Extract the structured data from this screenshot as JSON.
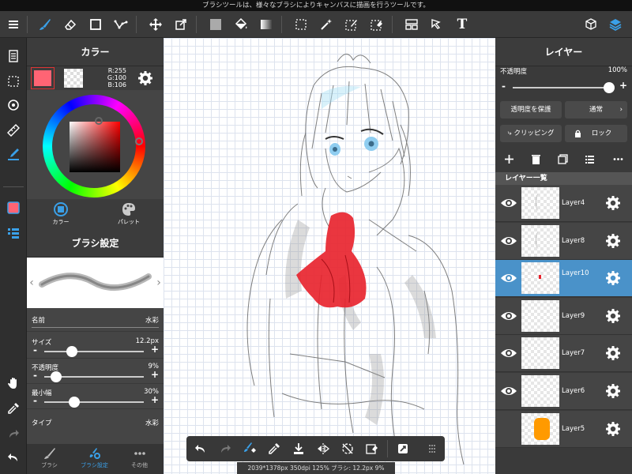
{
  "hint": "ブラシツールは、様々なブラシによりキャンバスに描画を行うツールです。",
  "toolbar": {
    "icons": [
      "menu-icon",
      "brush-icon",
      "eraser-icon",
      "rect-icon",
      "smooth-icon",
      "move-icon",
      "transform-icon",
      "fill-icon",
      "bucket-icon",
      "gradient-icon",
      "select-icon",
      "magic-wand-icon",
      "select-pen-icon",
      "select-eraser-icon",
      "layout-icon",
      "operation-icon",
      "text-icon",
      "3d-icon",
      "layers-icon"
    ],
    "text_tool_glyph": "T"
  },
  "color_panel": {
    "title": "カラー",
    "r": "R:255",
    "g": "G:100",
    "b": "B:106",
    "tab_color": "カラー",
    "tab_palette": "パレット",
    "primary": "#ff6474"
  },
  "brush_panel": {
    "title": "ブラシ設定",
    "name_label": "名前",
    "name_value": "水彩",
    "size_label": "サイズ",
    "size_value": "12.2px",
    "size_level": 0.28,
    "opacity_label": "不透明度",
    "opacity_value": "9%",
    "opacity_level": 0.12,
    "minwidth_label": "最小幅",
    "minwidth_value": "30%",
    "minwidth_level": 0.3,
    "type_label": "タイプ",
    "type_value": "水彩",
    "minus": "-",
    "plus": "+"
  },
  "bottom_tabs": [
    "ブラシ",
    "ブラシ設定",
    "その他"
  ],
  "status": "2039*1378px 350dpi 125% ブラシ: 12.2px 9%",
  "layer_panel": {
    "title": "レイヤー",
    "opacity_label": "不透明度",
    "opacity_value": "100%",
    "opacity_level": 1.0,
    "protect_alpha": "透明度を保護",
    "blend_mode": "通常",
    "clipping": "クリッピング",
    "lock": "ロック",
    "list_header": "レイヤー一覧",
    "layers": [
      {
        "name": "Layer4",
        "selected": false
      },
      {
        "name": "Layer8",
        "selected": false
      },
      {
        "name": "Layer10",
        "selected": true
      },
      {
        "name": "Layer9",
        "selected": false
      },
      {
        "name": "Layer7",
        "selected": false
      },
      {
        "name": "Layer6",
        "selected": false
      },
      {
        "name": "Layer5",
        "selected": false
      }
    ]
  },
  "colors": {
    "accent": "#4a92c9",
    "ribbon": "#e8202a",
    "layer5_thumb": "#ff9a00"
  }
}
